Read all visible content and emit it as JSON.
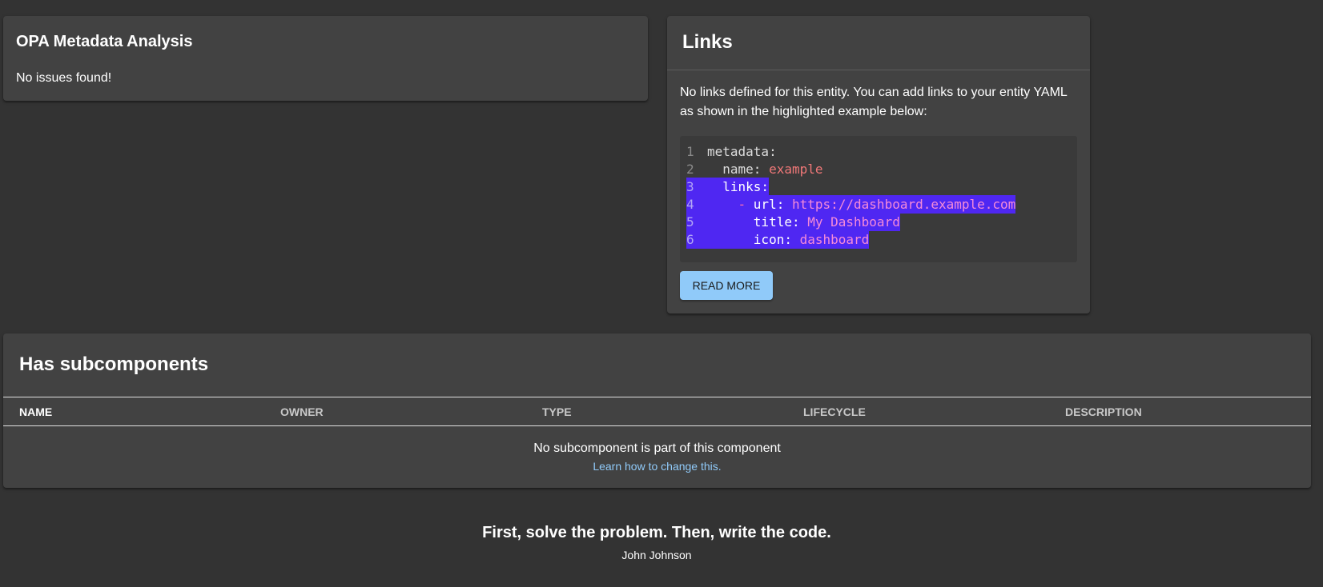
{
  "opa": {
    "title": "OPA Metadata Analysis",
    "message": "No issues found!"
  },
  "links": {
    "title": "Links",
    "description": "No links defined for this entity. You can add links to your entity YAML as shown in the highlighted example below:",
    "code": [
      {
        "num": "1",
        "indent": "",
        "key": "metadata:",
        "value": ""
      },
      {
        "num": "2",
        "indent": "  ",
        "key": "name: ",
        "value": "example"
      },
      {
        "num": "3",
        "indent": "  ",
        "key": "links:",
        "value": ""
      },
      {
        "num": "4",
        "indent": "    ",
        "dash": "- ",
        "key": "url: ",
        "value": "https://dashboard.example.com"
      },
      {
        "num": "5",
        "indent": "      ",
        "key": "title: ",
        "value": "My Dashboard"
      },
      {
        "num": "6",
        "indent": "      ",
        "key": "icon: ",
        "value": "dashboard"
      }
    ],
    "read_more_label": "READ MORE"
  },
  "subcomponents": {
    "title": "Has subcomponents",
    "columns": [
      "NAME",
      "OWNER",
      "TYPE",
      "LIFECYCLE",
      "DESCRIPTION"
    ],
    "empty_message": "No subcomponent is part of this component",
    "empty_link": "Learn how to change this."
  },
  "quote": {
    "text": "First, solve the problem. Then, write the code.",
    "author": "John Johnson"
  },
  "colors": {
    "background": "#333333",
    "card": "#424242",
    "highlight": "#4f27f2",
    "accent": "#90caf9"
  }
}
